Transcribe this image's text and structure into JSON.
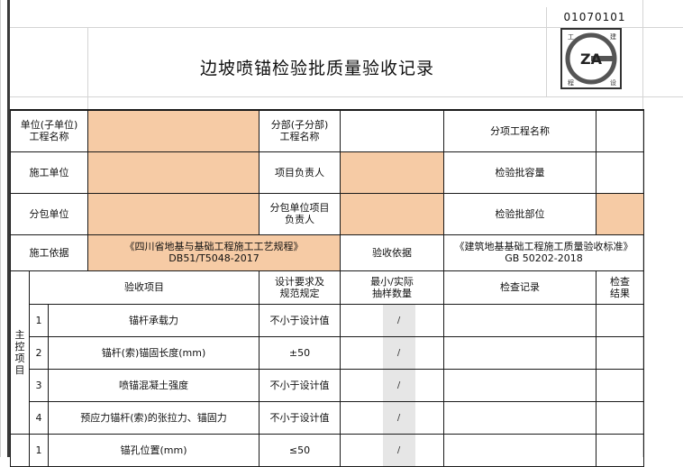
{
  "doc": {
    "code": "01070101",
    "title": "边坡喷锚检验批质量验收记录",
    "logo": {
      "text": "ZA",
      "corners": [
        "工",
        "建",
        "程",
        "设"
      ]
    }
  },
  "info": {
    "unit_project_label": "单位(子单位)\n工程名称",
    "sub_division_label": "分部(子分部)\n工程名称",
    "sub_item_label": "分项工程名称",
    "construction_unit_label": "施工单位",
    "project_manager_label": "项目负责人",
    "batch_capacity_label": "检验批容量",
    "subcontract_unit_label": "分包单位",
    "subcontract_manager_label": "分包单位项目\n负责人",
    "batch_location_label": "检验批部位",
    "construction_basis_label": "施工依据",
    "construction_basis_value": "《四川省地基与基础工程施工工艺规程》\nDB51/T5048-2017",
    "acceptance_basis_label": "验收依据",
    "acceptance_basis_value": "《建筑地基基础工程施工质量验收标准》\nGB 50202-2018"
  },
  "headers": {
    "item": "验收项目",
    "design": "设计要求及\n规范规定",
    "sample": "最小/实际\n抽样数量",
    "record": "检查记录",
    "result": "检查\n结果"
  },
  "main_group_label": "主控项目",
  "main_items": [
    {
      "no": "1",
      "name": "锚杆承载力",
      "spec": "不小于设计值",
      "sample": "/"
    },
    {
      "no": "2",
      "name": "锚杆(索)锚固长度(mm)",
      "spec": "±50",
      "sample": "/"
    },
    {
      "no": "3",
      "name": "喷锚混凝土强度",
      "spec": "不小于设计值",
      "sample": "/"
    },
    {
      "no": "4",
      "name": "预应力锚杆(索)的张拉力、锚固力",
      "spec": "不小于设计值",
      "sample": "/"
    }
  ],
  "general_items": [
    {
      "no": "1",
      "name": "锚孔位置(mm)",
      "spec": "≤50",
      "sample": "/"
    }
  ]
}
